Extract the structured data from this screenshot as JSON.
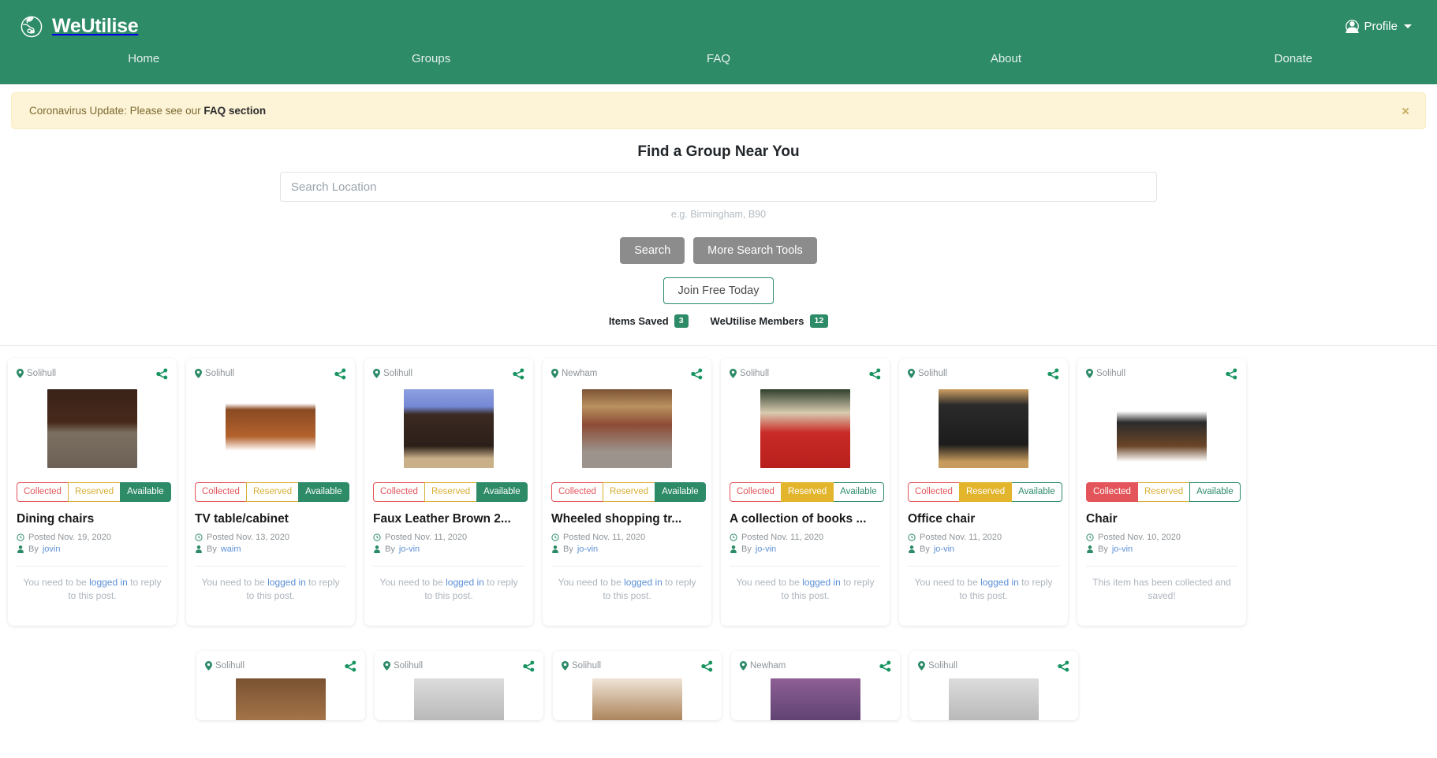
{
  "navbar": {
    "brand": "WeUtilise",
    "brand_icon": "globe-leaf-logo",
    "profile_label": "Profile",
    "profile_icon": "user-circle-icon",
    "links": [
      "Home",
      "Groups",
      "FAQ",
      "About",
      "Donate"
    ]
  },
  "alert": {
    "text_prefix": "Coronavirus Update: Please see our ",
    "link_text": "FAQ section",
    "close_icon": "close-icon",
    "close_label": "×",
    "bg_color": "#fdf3d7"
  },
  "hero": {
    "heading": "Find a Group Near You",
    "search_value": "",
    "search_placeholder": "Search Location",
    "hint": "e.g. Birmingham, B90",
    "search_button": "Search",
    "more_tools_button": "More Search Tools",
    "join_button": "Join Free Today",
    "counters": [
      {
        "label": "Items Saved",
        "value": "3"
      },
      {
        "label": "WeUtilise Members",
        "value": "12"
      }
    ],
    "accent_color": "#2d8b68"
  },
  "statuses": [
    "Collected",
    "Reserved",
    "Available"
  ],
  "cards": [
    {
      "location": "Solihull",
      "title": "Dining chairs",
      "posted": "Posted Nov. 19, 2020",
      "by_prefix": "By ",
      "author": "jovin",
      "status": "Available",
      "foot_prefix": "You need to be ",
      "foot_link": "logged in",
      "foot_suffix": " to reply to this post.",
      "image_desc": "four-white-dining-chairs"
    },
    {
      "location": "Solihull",
      "title": "TV table/cabinet",
      "posted": "Posted Nov. 13, 2020",
      "by_prefix": "By ",
      "author": "waim",
      "status": "Available",
      "foot_prefix": "You need to be ",
      "foot_link": "logged in",
      "foot_suffix": " to reply to this post.",
      "image_desc": "wooden-tv-cabinet"
    },
    {
      "location": "Solihull",
      "title": "Faux Leather Brown 2...",
      "posted": "Posted Nov. 11, 2020",
      "by_prefix": "By ",
      "author": "jo-vin",
      "status": "Available",
      "foot_prefix": "You need to be ",
      "foot_link": "logged in",
      "foot_suffix": " to reply to this post.",
      "image_desc": "brown-leather-sofa"
    },
    {
      "location": "Newham",
      "title": "Wheeled shopping tr...",
      "posted": "Posted Nov. 11, 2020",
      "by_prefix": "By ",
      "author": "jo-vin",
      "status": "Available",
      "foot_prefix": "You need to be ",
      "foot_link": "logged in",
      "foot_suffix": " to reply to this post.",
      "image_desc": "wheeled-shopping-trolley"
    },
    {
      "location": "Solihull",
      "title": "A collection of books ...",
      "posted": "Posted Nov. 11, 2020",
      "by_prefix": "By ",
      "author": "jo-vin",
      "status": "Reserved",
      "foot_prefix": "You need to be ",
      "foot_link": "logged in",
      "foot_suffix": " to reply to this post.",
      "image_desc": "books-in-red-crate"
    },
    {
      "location": "Solihull",
      "title": "Office chair",
      "posted": "Posted Nov. 11, 2020",
      "by_prefix": "By ",
      "author": "jo-vin",
      "status": "Reserved",
      "foot_prefix": "You need to be ",
      "foot_link": "logged in",
      "foot_suffix": " to reply to this post.",
      "image_desc": "black-office-chair"
    },
    {
      "location": "Solihull",
      "title": "Chair",
      "posted": "Posted Nov. 10, 2020",
      "by_prefix": "By ",
      "author": "jo-vin",
      "status": "Collected",
      "foot_text": "This item has been collected and saved!",
      "image_desc": "eames-lounge-chair-and-ottoman"
    }
  ],
  "cards_row2": [
    {
      "location": "Solihull",
      "image_desc": "wooden-furniture"
    },
    {
      "location": "Solihull",
      "image_desc": "item-photo"
    },
    {
      "location": "Solihull",
      "image_desc": "person-photo"
    },
    {
      "location": "Newham",
      "image_desc": "purple-item"
    },
    {
      "location": "Solihull",
      "image_desc": "item-photo"
    }
  ]
}
